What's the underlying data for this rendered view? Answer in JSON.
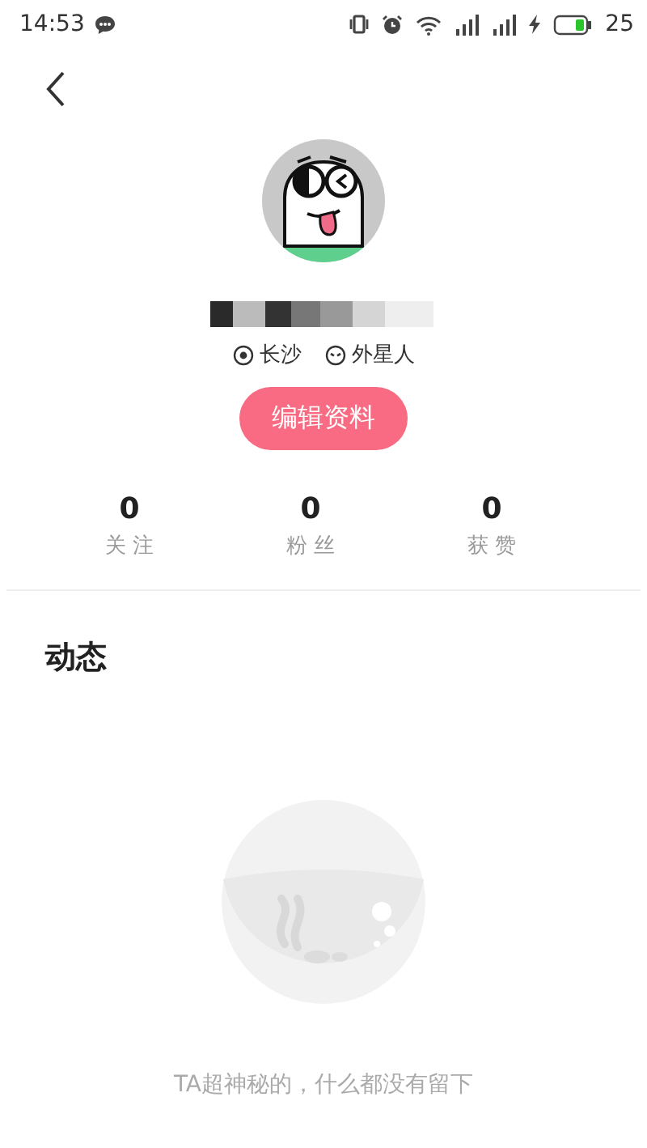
{
  "status_bar": {
    "time": "14:53",
    "battery_level": "25"
  },
  "profile": {
    "location": "长沙",
    "identity": "外星人",
    "edit_button": "编辑资料"
  },
  "stats": [
    {
      "value": "0",
      "label": "关 注"
    },
    {
      "value": "0",
      "label": "粉 丝"
    },
    {
      "value": "0",
      "label": "获 赞"
    }
  ],
  "feed": {
    "title": "动态",
    "empty_text": "TA超神秘的，什么都没有留下"
  }
}
